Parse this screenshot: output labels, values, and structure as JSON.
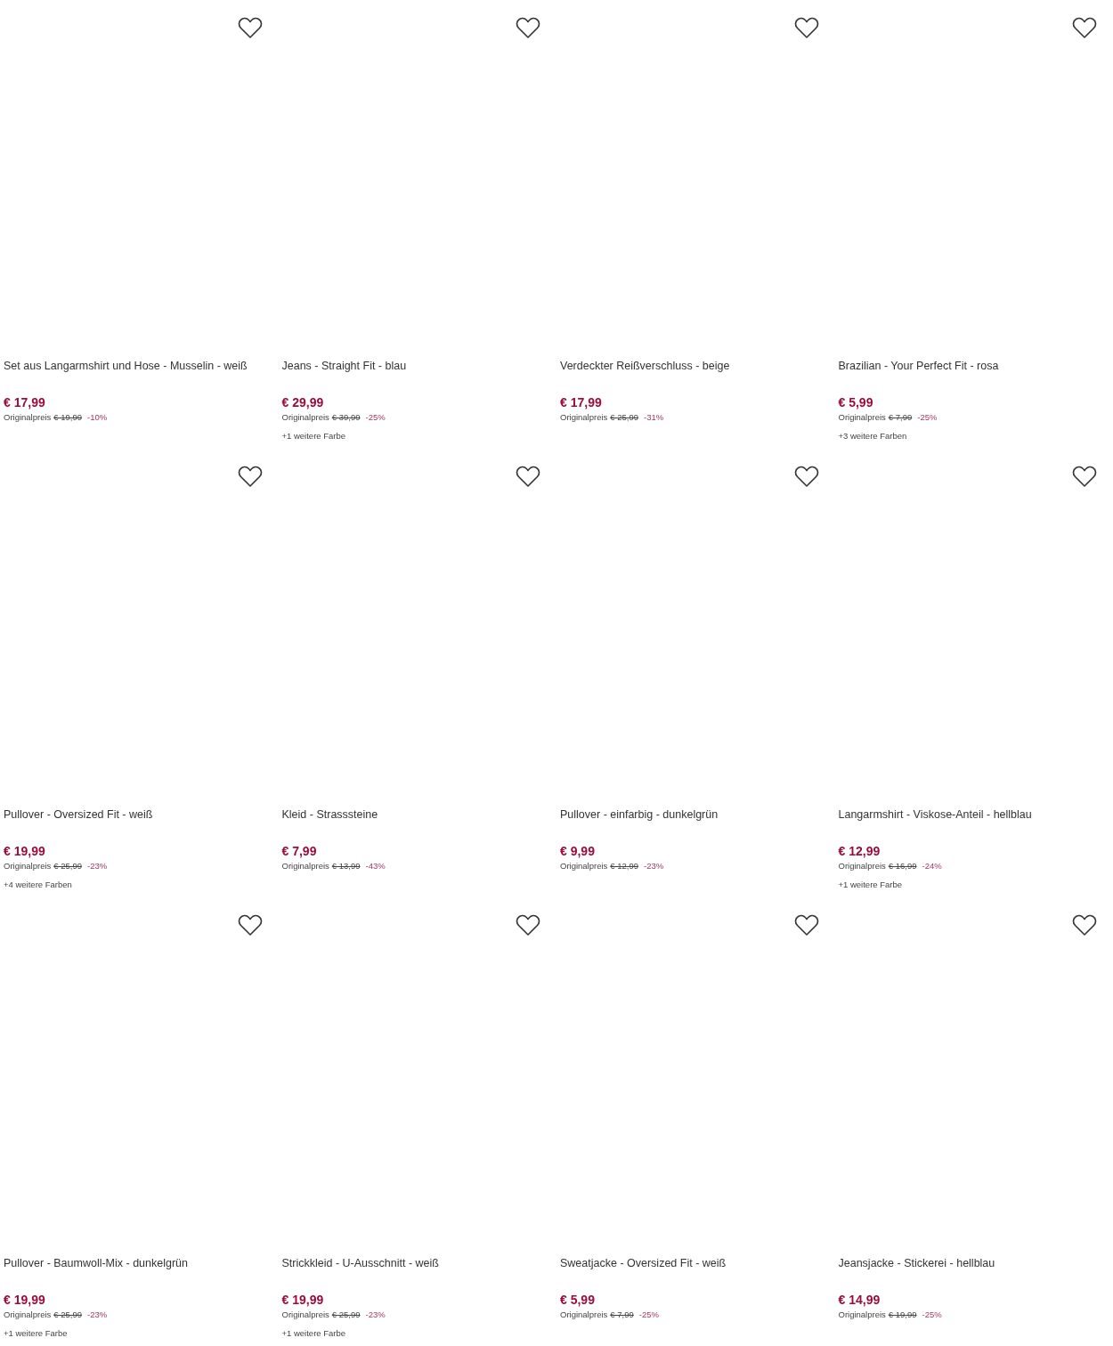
{
  "products": [
    {
      "title": "Set aus Langarmshirt und Hose - Musselin - weiß",
      "price": "€ 17,99",
      "original_label": "Originalpreis",
      "original_price": "€ 19,99",
      "discount": "-10%",
      "favorited": false
    },
    {
      "title": "Jeans - Straight Fit - blau",
      "price": "€ 29,99",
      "original_label": "Originalpreis",
      "original_price": "€ 39,99",
      "discount": "-25%",
      "more_colors": "+1 weitere Farbe",
      "favorited": false
    },
    {
      "title": "Verdeckter Reißverschluss - beige",
      "price": "€ 17,99",
      "original_label": "Originalpreis",
      "original_price": "€ 25,99",
      "discount": "-31%",
      "favorited": false
    },
    {
      "title": "Brazilian - Your Perfect Fit - rosa",
      "price": "€ 5,99",
      "original_label": "Originalpreis",
      "original_price": "€ 7,99",
      "discount": "-25%",
      "more_colors": "+3 weitere Farben",
      "favorited": false
    },
    {
      "title": "Pullover - Oversized Fit - weiß",
      "price": "€ 19,99",
      "original_label": "Originalpreis",
      "original_price": "€ 25,99",
      "discount": "-23%",
      "more_colors": "+4 weitere Farben",
      "favorited": false
    },
    {
      "title": "Kleid - Strasssteine",
      "price": "€ 7,99",
      "original_label": "Originalpreis",
      "original_price": "€ 13,99",
      "discount": "-43%",
      "favorited": false
    },
    {
      "title": "Pullover - einfarbig - dunkelgrün",
      "price": "€ 9,99",
      "original_label": "Originalpreis",
      "original_price": "€ 12,99",
      "discount": "-23%",
      "favorited": false
    },
    {
      "title": "Langarmshirt - Viskose-Anteil - hellblau",
      "price": "€ 12,99",
      "original_label": "Originalpreis",
      "original_price": "€ 16,99",
      "discount": "-24%",
      "more_colors": "+1 weitere Farbe",
      "favorited": false
    },
    {
      "title": "Pullover - Baumwoll-Mix - dunkelgrün",
      "price": "€ 19,99",
      "original_label": "Originalpreis",
      "original_price": "€ 25,99",
      "discount": "-23%",
      "more_colors": "+1 weitere Farbe",
      "favorited": false
    },
    {
      "title": "Strickkleid - U-Ausschnitt - weiß",
      "price": "€ 19,99",
      "original_label": "Originalpreis",
      "original_price": "€ 25,99",
      "discount": "-23%",
      "more_colors": "+1 weitere Farbe",
      "favorited": false
    },
    {
      "title": "Sweatjacke - Oversized Fit - weiß",
      "price": "€ 5,99",
      "original_label": "Originalpreis",
      "original_price": "€ 7,99",
      "discount": "-25%",
      "favorited": false
    },
    {
      "title": "Jeansjacke - Stickerei - hellblau",
      "price": "€ 14,99",
      "original_label": "Originalpreis",
      "original_price": "€ 19,99",
      "discount": "-25%",
      "favorited": false
    }
  ]
}
